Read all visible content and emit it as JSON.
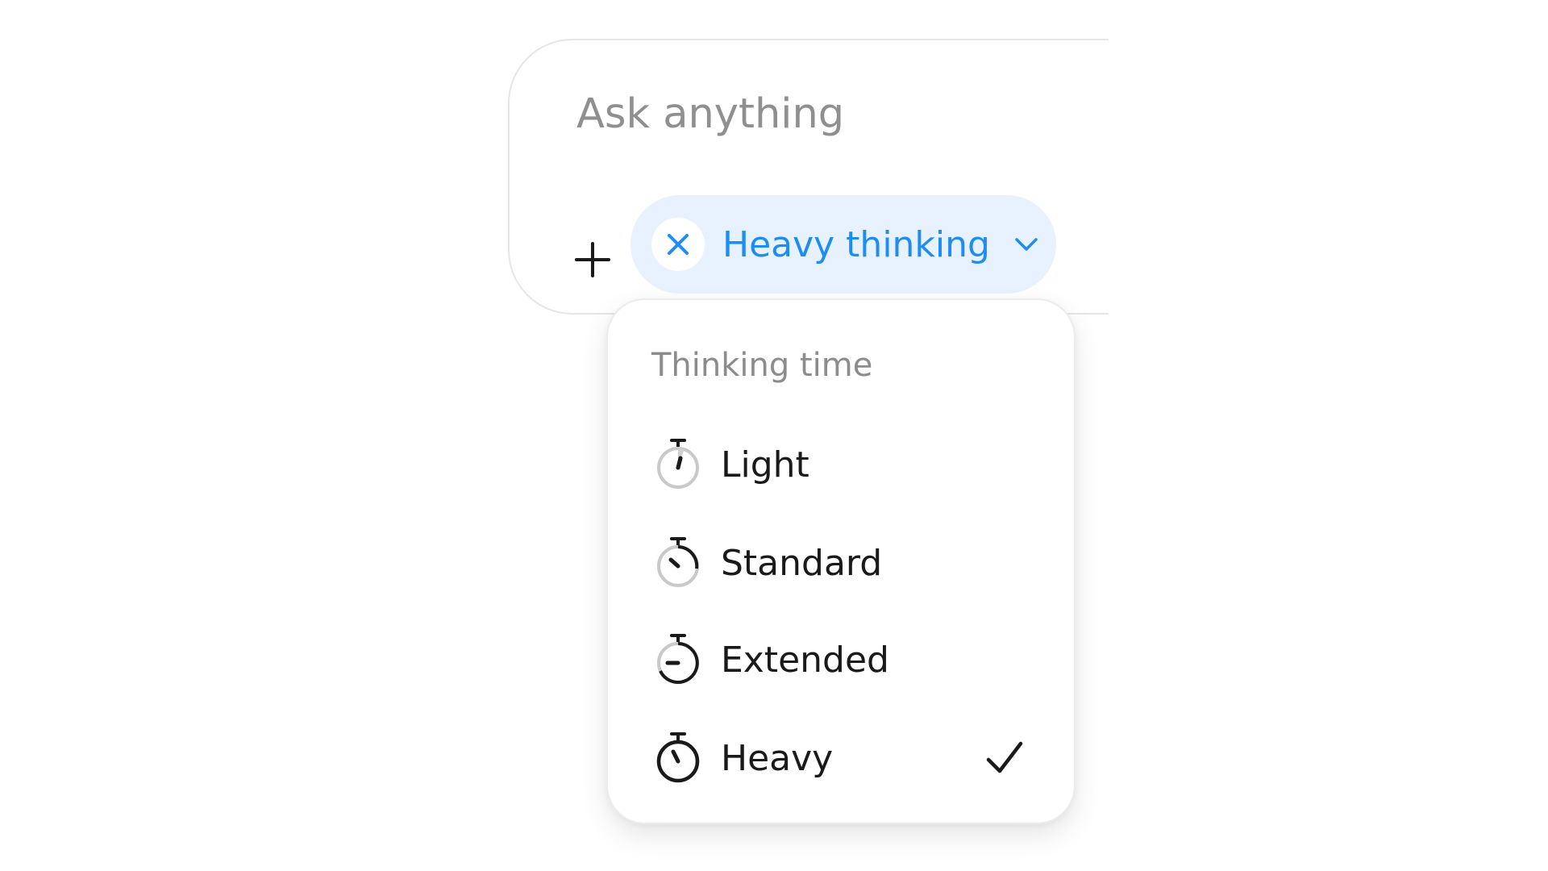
{
  "composer": {
    "placeholder": "Ask anything",
    "add_icon": "plus-icon",
    "mode_pill": {
      "label": "Heavy thinking",
      "clear_icon": "close-icon",
      "dropdown_icon": "chevron-down-icon",
      "color": "#1d8cf5",
      "background": "#e7f2fe"
    }
  },
  "thinking_menu": {
    "header": "Thinking time",
    "items": [
      {
        "label": "Light",
        "icon": "stopwatch-light-icon",
        "selected": false
      },
      {
        "label": "Standard",
        "icon": "stopwatch-standard-icon",
        "selected": false
      },
      {
        "label": "Extended",
        "icon": "stopwatch-extended-icon",
        "selected": false
      },
      {
        "label": "Heavy",
        "icon": "stopwatch-heavy-icon",
        "selected": true
      }
    ],
    "selected_indicator_icon": "checkmark-icon"
  }
}
